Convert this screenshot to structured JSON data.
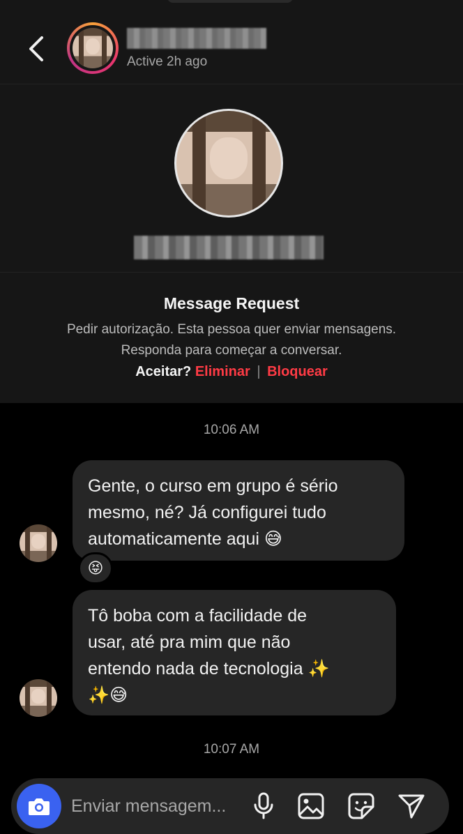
{
  "header": {
    "status": "Active 2h ago"
  },
  "message_request": {
    "title": "Message Request",
    "description_line1": "Pedir autorização. Esta pessoa quer enviar mensagens.",
    "description_line2": "Responda para começar a conversar.",
    "accept_label": "Aceitar?",
    "delete_label": "Eliminar",
    "separator": "|",
    "block_label": "Bloquear",
    "danger_color": "#ff3b45"
  },
  "conversation": {
    "timestamps": [
      "10:06 AM",
      "10:07 AM"
    ],
    "messages": [
      {
        "text": "Gente, o curso em grupo é sério\nmesmo, né? Já configurei tudo\nautomaticamente aqui 😅",
        "reaction": "😝"
      },
      {
        "text": "Tô boba com a facilidade de\nusar, até pra mim que não\nentendo nada de tecnologia ✨\n✨😅"
      }
    ]
  },
  "composer": {
    "placeholder": "Enviar mensagem...",
    "accent_color": "#3a62f0",
    "icons": [
      "camera-icon",
      "microphone-icon",
      "gallery-icon",
      "sticker-icon",
      "send-icon"
    ]
  }
}
